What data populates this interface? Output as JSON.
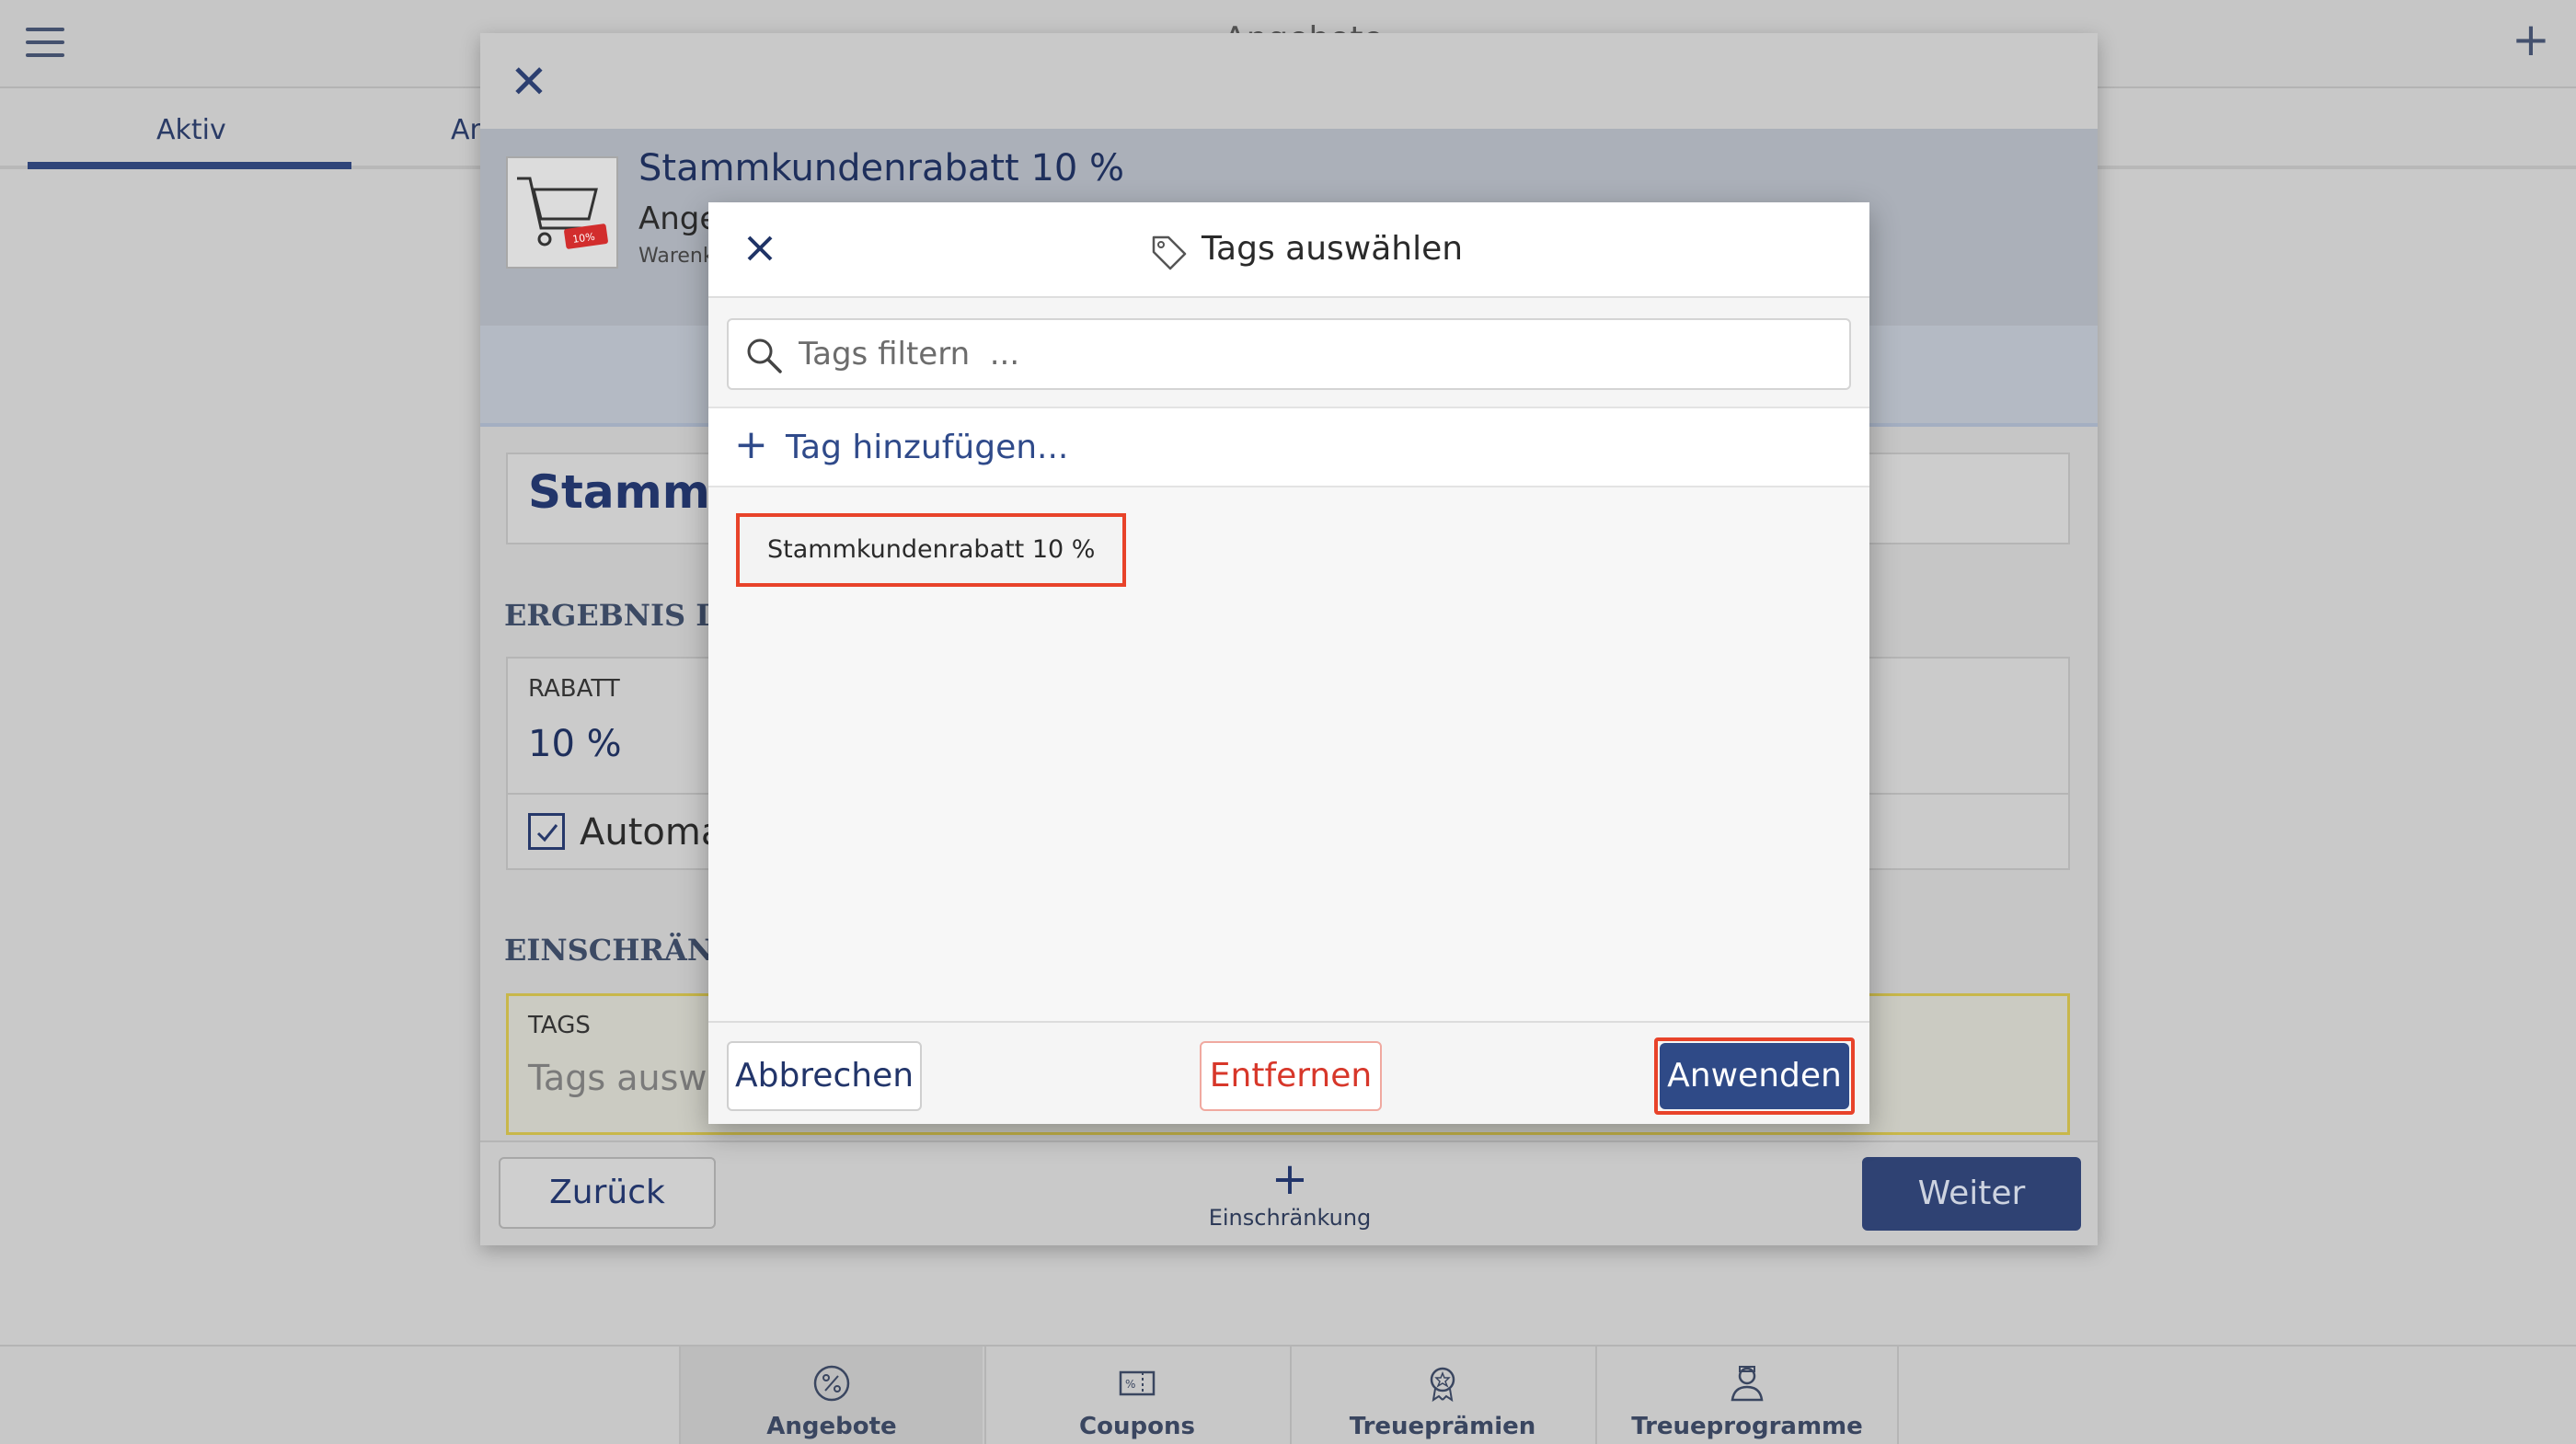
{
  "app": {
    "title": "Angebote",
    "tabs": [
      "Aktiv",
      "An"
    ],
    "bottom_nav": [
      {
        "label": "Angebote",
        "icon": "percent-badge-icon",
        "active": true
      },
      {
        "label": "Coupons",
        "icon": "coupon-icon",
        "active": false
      },
      {
        "label": "Treueprämien",
        "icon": "reward-icon",
        "active": false
      },
      {
        "label": "Treueprogramme",
        "icon": "loyalty-person-icon",
        "active": false
      }
    ]
  },
  "wizard": {
    "offer_title": "Stammkundenrabatt 10 %",
    "offer_sub1": "Ange",
    "offer_sub2": "Warenk",
    "name_field": "Stammku",
    "section_result": "ERGEBNIS DES",
    "rabatt_label": "RABATT",
    "rabatt_value": "10 %",
    "auto_label": "Automat",
    "section_restriction": "EINSCHRÄNKU",
    "tags_label": "TAGS",
    "tags_placeholder": "Tags auswä",
    "back_label": "Zurück",
    "add_restriction_label": "Einschränkung",
    "next_label": "Weiter"
  },
  "modal": {
    "title": "Tags auswählen",
    "search_placeholder": "Tags filtern  ...",
    "add_tag_label": "Tag hinzufügen...",
    "tags": [
      "Stammkundenrabatt 10 %"
    ],
    "cancel_label": "Abbrechen",
    "remove_label": "Entfernen",
    "apply_label": "Anwenden"
  },
  "colors": {
    "accent": "#2f4a87",
    "danger": "#d7372a",
    "highlight": "#e8432a"
  }
}
